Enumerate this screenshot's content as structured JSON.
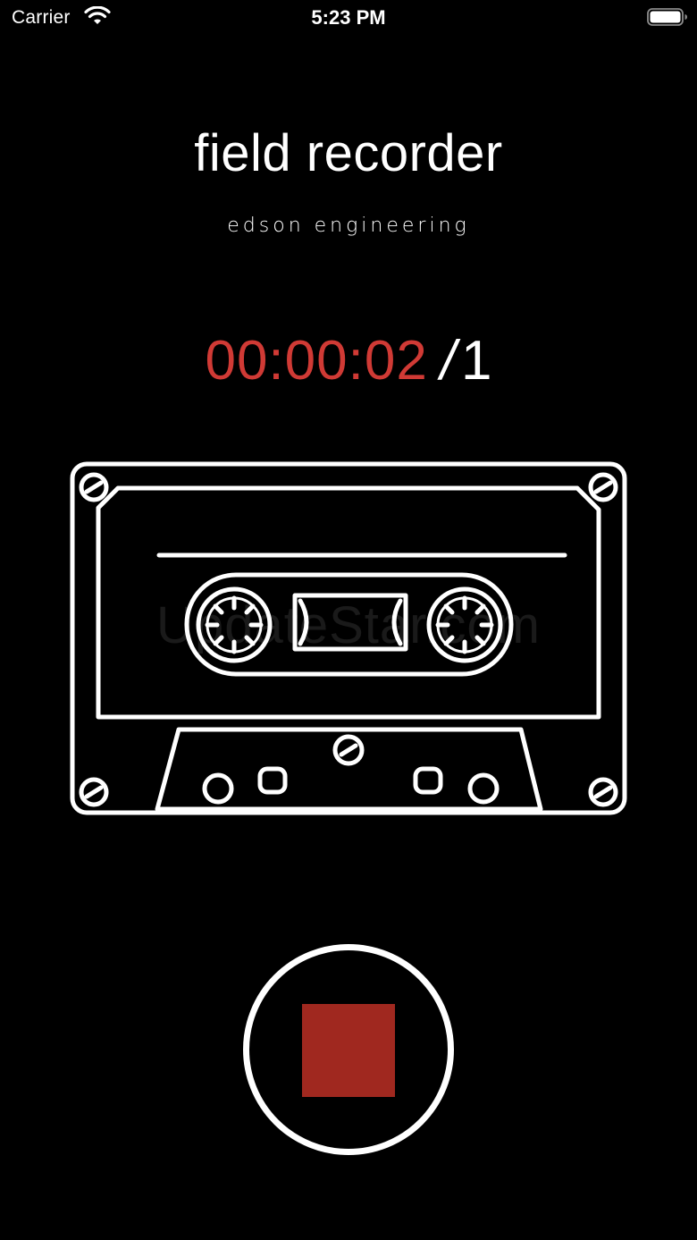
{
  "status_bar": {
    "carrier": "Carrier",
    "time": "5:23 PM",
    "icons": [
      "wifi-icon",
      "battery-icon"
    ]
  },
  "header": {
    "title": "field recorder",
    "subtitle": "edson engineering"
  },
  "timer": {
    "elapsed": "00:00:02",
    "separator": "/",
    "recording_count": "1"
  },
  "cassette": {
    "icon": "cassette-tape-icon"
  },
  "watermark": {
    "text": "UpdateStar.com"
  },
  "controls": {
    "stop_icon": "stop-icon"
  },
  "colors": {
    "background": "#000000",
    "timer_accent": "#d03a35",
    "stop_fill": "#a0281f",
    "foreground": "#ffffff"
  }
}
